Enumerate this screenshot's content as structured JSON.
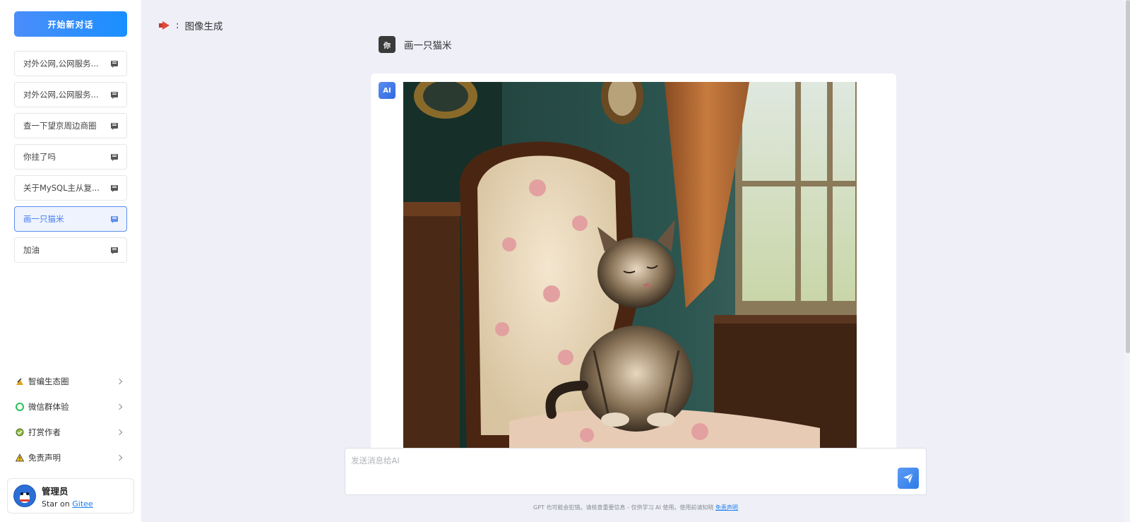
{
  "sidebar": {
    "new_chat_label": "开始新对话",
    "conversations": [
      {
        "label": "对外公网,公网服务...",
        "active": false
      },
      {
        "label": "对外公网,公网服务...",
        "active": false
      },
      {
        "label": "查一下望京周边商圈",
        "active": false
      },
      {
        "label": "你挂了吗",
        "active": false
      },
      {
        "label": "关于MySQL主从复...",
        "active": false
      },
      {
        "label": "画一只猫米",
        "active": true
      },
      {
        "label": "加油",
        "active": false
      }
    ],
    "menu": [
      {
        "label": "智编生态圈",
        "icon": "sparkle-icon"
      },
      {
        "label": "微信群体验",
        "icon": "wechat-icon"
      },
      {
        "label": "打赏作者",
        "icon": "gift-icon"
      },
      {
        "label": "免责声明",
        "icon": "warning-icon"
      }
    ],
    "user": {
      "name": "管理员",
      "sub_prefix": "Star on ",
      "sub_link": "Gitee"
    }
  },
  "header": {
    "icon": "megaphone-icon",
    "colon": ":",
    "title": "图像生成"
  },
  "chat": {
    "user_badge": "你",
    "user_message": "画一只猫米",
    "ai_badge": "AI",
    "ai_image_alt": "kitten on antique chair"
  },
  "composer": {
    "placeholder": "发送消息给AI"
  },
  "footer": {
    "disclaimer_text": "GPT 也可能会犯错。请核查重要信息 - 仅供学习 AI 使用。使用前请知晓",
    "disclaimer_link": "免责声明"
  },
  "colors": {
    "accent": "#1a8fff",
    "active_border": "#5b8def",
    "background": "#eeeff7"
  }
}
